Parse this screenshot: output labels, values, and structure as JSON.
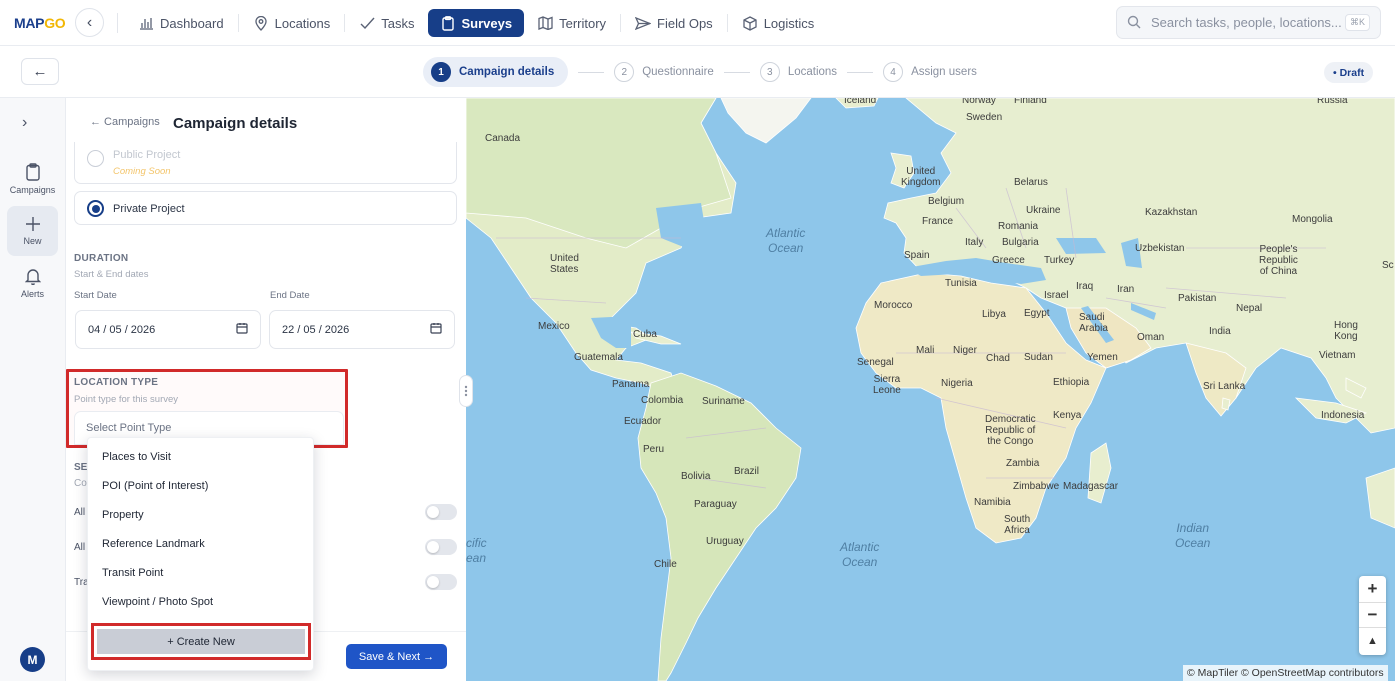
{
  "app": {
    "logo_main": "MAP",
    "logo_accent": "GO"
  },
  "nav": {
    "items": [
      {
        "label": "Dashboard",
        "icon": "chart-icon"
      },
      {
        "label": "Locations",
        "icon": "pin-icon"
      },
      {
        "label": "Tasks",
        "icon": "check-icon"
      },
      {
        "label": "Surveys",
        "icon": "clipboard-icon",
        "active": true
      },
      {
        "label": "Territory",
        "icon": "map-icon"
      },
      {
        "label": "Field Ops",
        "icon": "send-icon"
      },
      {
        "label": "Logistics",
        "icon": "box-icon"
      }
    ],
    "search_placeholder": "Search tasks, people, locations...",
    "search_shortcut": "⌘K"
  },
  "stepper": {
    "steps": [
      {
        "num": "1",
        "label": "Campaign details"
      },
      {
        "num": "2",
        "label": "Questionnaire"
      },
      {
        "num": "3",
        "label": "Locations"
      },
      {
        "num": "4",
        "label": "Assign users"
      }
    ],
    "status": "• Draft"
  },
  "rail": {
    "items": [
      {
        "label": "Campaigns"
      },
      {
        "label": "New"
      },
      {
        "label": "Alerts"
      }
    ],
    "avatar_initial": "M"
  },
  "panel": {
    "breadcrumb": "← Campaigns",
    "title": "Campaign details",
    "public_project": {
      "label": "Public Project",
      "note": "Coming Soon"
    },
    "private_project": {
      "label": "Private Project"
    },
    "duration": {
      "heading": "DURATION",
      "sub": "Start & End dates",
      "start_label": "Start Date",
      "start_value": "04 / 05 / 2026",
      "end_label": "End Date",
      "end_value": "22 / 05 / 2026"
    },
    "location_type": {
      "heading": "LOCATION TYPE",
      "sub": "Point type for this survey",
      "placeholder": "Select Point Type"
    },
    "behind": {
      "sec": "SE",
      "sub": "Co",
      "row1": "All",
      "row2": "All",
      "row3": "Tra"
    },
    "save_label": "Save & Next →"
  },
  "dropdown": {
    "options": [
      "Places to Visit",
      "POI (Point of Interest)",
      "Property",
      "Reference Landmark",
      "Transit Point",
      "Viewpoint / Photo Spot"
    ],
    "create_label": "+ Create New"
  },
  "map": {
    "labels": [
      {
        "t": "Iceland"
      },
      {
        "t": "Norway"
      },
      {
        "t": "Finland"
      },
      {
        "t": "Russia"
      },
      {
        "t": "Sweden"
      },
      {
        "t": "Canada"
      },
      {
        "t": "United\nKingdom"
      },
      {
        "t": "Belarus"
      },
      {
        "t": "Belgium"
      },
      {
        "t": "Ukraine"
      },
      {
        "t": "France"
      },
      {
        "t": "Romania"
      },
      {
        "t": "Kazakhstan"
      },
      {
        "t": "Mongolia"
      },
      {
        "t": "Italy"
      },
      {
        "t": "Bulgaria"
      },
      {
        "t": "Uzbekistan"
      },
      {
        "t": "People's\nRepublic\nof China"
      },
      {
        "t": "Spain"
      },
      {
        "t": "Greece"
      },
      {
        "t": "Turkey"
      },
      {
        "t": "United\nStates"
      },
      {
        "t": "Tunisia"
      },
      {
        "t": "Iraq"
      },
      {
        "t": "Iran"
      },
      {
        "t": "Israel"
      },
      {
        "t": "Morocco"
      },
      {
        "t": "Pakistan"
      },
      {
        "t": "Nepal"
      },
      {
        "t": "Libya"
      },
      {
        "t": "Egypt"
      },
      {
        "t": "Saudi\nArabia"
      },
      {
        "t": "Mexico"
      },
      {
        "t": "India"
      },
      {
        "t": "Hong\nKong"
      },
      {
        "t": "Oman"
      },
      {
        "t": "Cuba"
      },
      {
        "t": "Guatemala"
      },
      {
        "t": "Mali"
      },
      {
        "t": "Niger"
      },
      {
        "t": "Chad"
      },
      {
        "t": "Sudan"
      },
      {
        "t": "Senegal"
      },
      {
        "t": "Yemen"
      },
      {
        "t": "Vietnam"
      },
      {
        "t": "Sierra\nLeone"
      },
      {
        "t": "Nigeria"
      },
      {
        "t": "Ethiopia"
      },
      {
        "t": "Panama"
      },
      {
        "t": "Sri Lanka"
      },
      {
        "t": "Colombia"
      },
      {
        "t": "Suriname"
      },
      {
        "t": "Ecuador"
      },
      {
        "t": "Kenya"
      },
      {
        "t": "Democratic\nRepublic of\nthe Congo"
      },
      {
        "t": "Indonesia"
      },
      {
        "t": "Peru"
      },
      {
        "t": "Brazil"
      },
      {
        "t": "Bolivia"
      },
      {
        "t": "Zambia"
      },
      {
        "t": "Zimbabwe"
      },
      {
        "t": "Madagascar"
      },
      {
        "t": "Paraguay"
      },
      {
        "t": "Namibia"
      },
      {
        "t": "South\nAfrica"
      },
      {
        "t": "Uruguay"
      },
      {
        "t": "Chile"
      },
      {
        "t": "Sc"
      }
    ],
    "oceans": [
      {
        "t": "Atlantic\nOcean"
      },
      {
        "t": "Atlantic\nOcean"
      },
      {
        "t": "Indian\nOcean"
      },
      {
        "t": "cific\nean"
      }
    ],
    "attribution": "© MapTiler © OpenStreetMap contributors",
    "zoom_in": "+",
    "zoom_out": "−",
    "north": "▲"
  },
  "colors": {
    "primary": "#173e88",
    "accent_button": "#1f55c7",
    "highlight": "#d12a2a",
    "water": "#8ec6ea",
    "land": "#e7eed0"
  }
}
